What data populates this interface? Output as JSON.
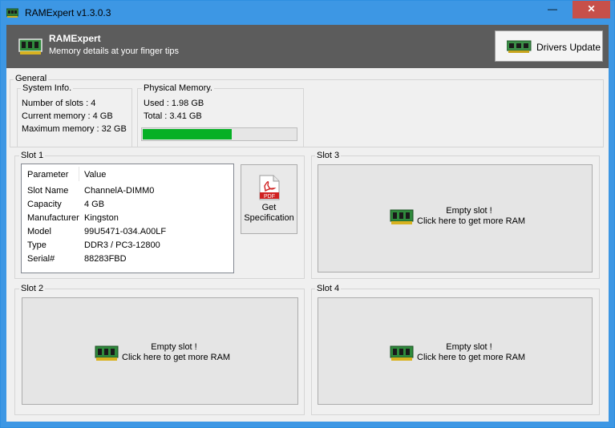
{
  "window": {
    "title": "RAMExpert v1.3.0.3",
    "controls": {
      "minimize": "—",
      "maximize": "☐",
      "close": "✕"
    }
  },
  "header": {
    "title": "RAMExpert",
    "subtitle": "Memory details at your finger tips",
    "drivers_button": "Drivers Update",
    "icon": "ram-module-icon"
  },
  "general": {
    "legend": "General",
    "system_info": {
      "legend": "System Info.",
      "slots": "Number of slots : 4",
      "current": "Current memory : 4 GB",
      "maximum": "Maximum memory : 32 GB"
    },
    "physical_memory": {
      "legend": "Physical Memory.",
      "used": "Used : 1.98 GB",
      "total": "Total : 3.41 GB",
      "usage_fraction": 0.58,
      "bar_color": "#06b025"
    }
  },
  "slot1": {
    "legend": "Slot 1",
    "columns": [
      "Parameter",
      "Value"
    ],
    "rows": [
      [
        "Slot Name",
        "ChannelA-DIMM0"
      ],
      [
        "Capacity",
        "4 GB"
      ],
      [
        "Manufacturer",
        "Kingston"
      ],
      [
        "Model",
        "99U5471-034.A00LF"
      ],
      [
        "Type",
        "DDR3 / PC3-12800"
      ],
      [
        "Serial#",
        "88283FBD"
      ]
    ],
    "spec_button": {
      "line1": "Get",
      "line2": "Specification",
      "icon": "pdf-icon",
      "icon_text": "PDF"
    }
  },
  "slot2": {
    "legend": "Slot 2",
    "line1": "Empty slot !",
    "line2": "Click here to get more RAM"
  },
  "slot3": {
    "legend": "Slot 3",
    "line1": "Empty slot !",
    "line2": "Click here to get more RAM"
  },
  "slot4": {
    "legend": "Slot 4",
    "line1": "Empty slot !",
    "line2": "Click here to get more RAM"
  },
  "colors": {
    "titlebar": "#3d97e4",
    "header": "#5c5c5c",
    "close": "#c7504a",
    "window_bg": "#f0f0f0"
  }
}
